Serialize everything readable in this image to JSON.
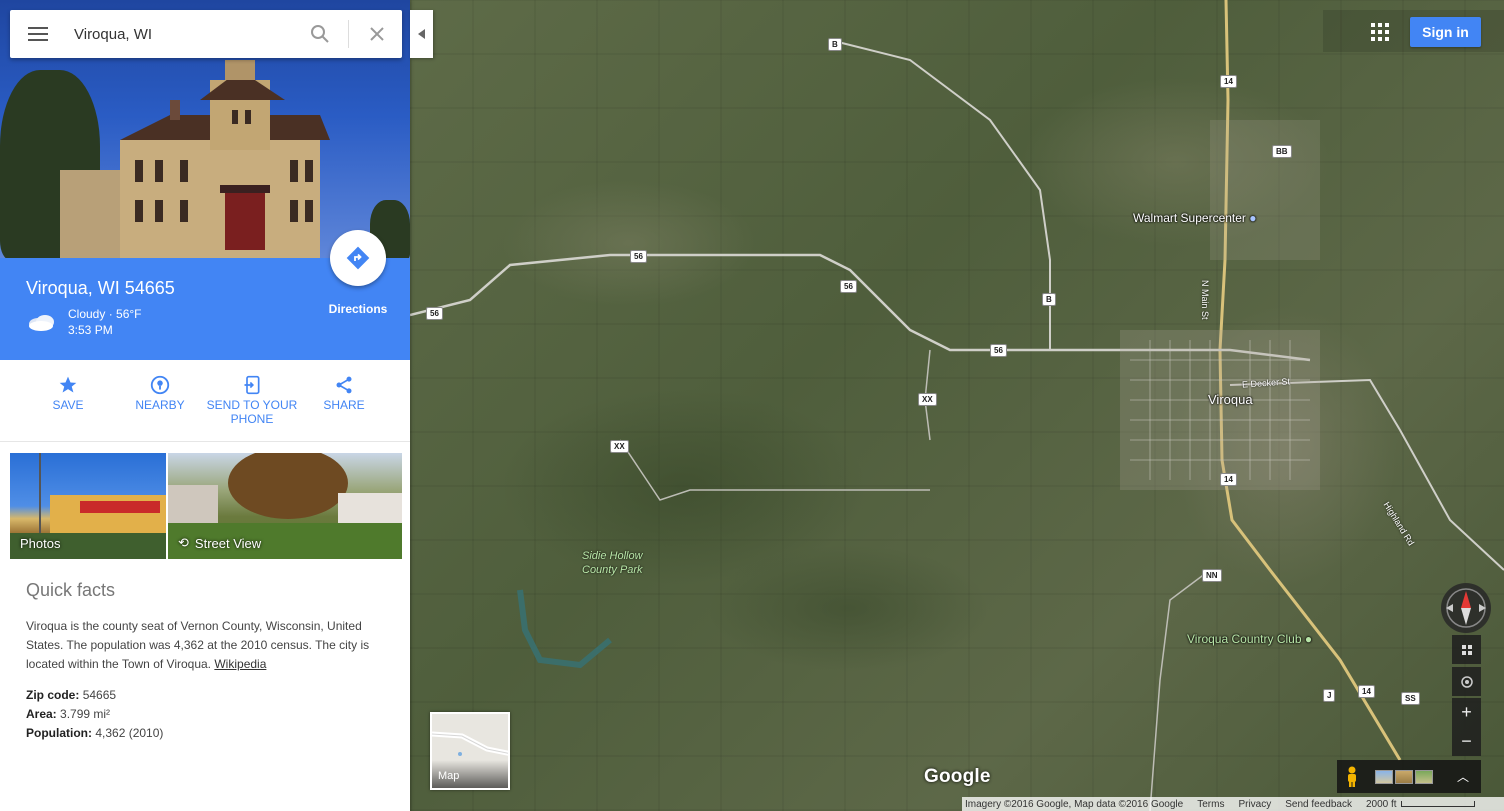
{
  "search": {
    "value": "Viroqua, WI"
  },
  "place": {
    "title": "Viroqua, WI 54665",
    "weather_condition": "Cloudy · 56°F",
    "weather_time": "3:53 PM",
    "directions_label": "Directions"
  },
  "actions": {
    "save": "SAVE",
    "nearby": "NEARBY",
    "send_line1": "SEND TO YOUR",
    "send_line2": "PHONE",
    "share": "SHARE"
  },
  "photos": {
    "photos_label": "Photos",
    "streetview_label": "Street View"
  },
  "facts": {
    "heading": "Quick facts",
    "description": "Viroqua is the county seat of Vernon County, Wisconsin, United States. The population was 4,362 at the 2010 census. The city is located within the Town of Viroqua.",
    "source_link": "Wikipedia",
    "zip_label": "Zip code:",
    "zip_value": "54665",
    "area_label": "Area:",
    "area_value": "3.799 mi²",
    "population_label": "Population:",
    "population_value": "4,362 (2010)"
  },
  "header": {
    "signin_label": "Sign in"
  },
  "map": {
    "labels": {
      "walmart": "Walmart Supercenter",
      "viroqua": "Viroqua",
      "country_club": "Viroqua Country Club",
      "park_line1": "Sidie Hollow",
      "park_line2": "County Park",
      "main_st": "N Main St",
      "decker_st": "E Decker St",
      "highland_rd": "Highland Rd"
    },
    "shields": {
      "b1": "B",
      "b2": "B",
      "r14a": "14",
      "r14b": "14",
      "r14c": "14",
      "bb": "BB",
      "r56a": "56",
      "r56b": "56",
      "r56c": "56",
      "r56d": "56",
      "xx1": "XX",
      "xx2": "XX",
      "nn": "NN",
      "j": "J",
      "ss": "SS"
    },
    "minimap_label": "Map",
    "google_logo": "Google"
  },
  "attribution": {
    "imagery": "Imagery ©2016 Google, Map data ©2016 Google",
    "terms": "Terms",
    "privacy": "Privacy",
    "feedback": "Send feedback",
    "scale": "2000 ft"
  },
  "colors": {
    "accent": "#4285f4",
    "park_label": "#b8e6a8"
  }
}
